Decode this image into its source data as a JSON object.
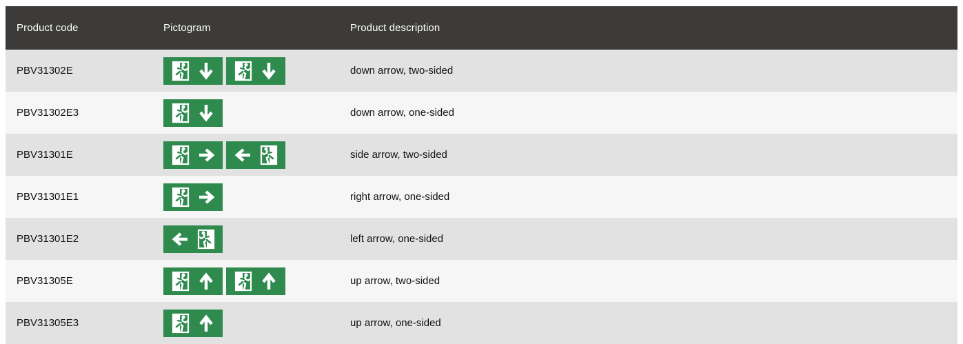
{
  "table": {
    "headers": {
      "code": "Product code",
      "pictogram": "Pictogram",
      "description": "Product description"
    },
    "rows": [
      {
        "code": "PBV31302E",
        "description": "down arrow, two-sided",
        "signs": [
          [
            "runner",
            "down"
          ],
          [
            "runner",
            "down"
          ]
        ]
      },
      {
        "code": "PBV31302E3",
        "description": "down arrow, one-sided",
        "signs": [
          [
            "runner",
            "down"
          ]
        ]
      },
      {
        "code": "PBV31301E",
        "description": "side arrow, two-sided",
        "signs": [
          [
            "runner",
            "right"
          ],
          [
            "left",
            "runner-flip"
          ]
        ]
      },
      {
        "code": "PBV31301E1",
        "description": "right arrow, one-sided",
        "signs": [
          [
            "runner",
            "right"
          ]
        ]
      },
      {
        "code": "PBV31301E2",
        "description": "left arrow, one-sided",
        "signs": [
          [
            "left",
            "runner-flip"
          ]
        ]
      },
      {
        "code": "PBV31305E",
        "description": "up arrow, two-sided",
        "signs": [
          [
            "runner",
            "up"
          ],
          [
            "runner",
            "up"
          ]
        ]
      },
      {
        "code": "PBV31305E3",
        "description": "up arrow, one-sided",
        "signs": [
          [
            "runner",
            "up"
          ]
        ]
      }
    ]
  },
  "colors": {
    "header_bg": "#3c3b39",
    "row_odd": "#e2e2e2",
    "row_even": "#f6f6f6",
    "sign_green": "#2f8a4e"
  }
}
